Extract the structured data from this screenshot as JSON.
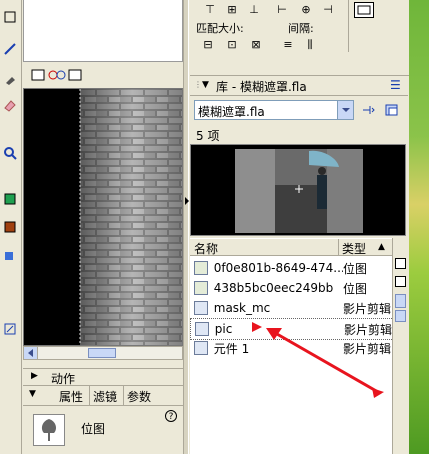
{
  "align_panel": {
    "match_size_label": "匹配大小:",
    "spacing_label": "间隔:"
  },
  "library": {
    "title": "库 - 模糊遮罩.fla",
    "dropdown_value": "模糊遮罩.fla",
    "item_count": "5 项",
    "col_name": "名称",
    "col_type": "类型",
    "items": [
      {
        "name": "0f0e801b-8649-474...",
        "type": "位图",
        "icon": "bitmap-icon"
      },
      {
        "name": "438b5bc0eec249bb",
        "type": "位图",
        "icon": "bitmap-icon"
      },
      {
        "name": "mask_mc",
        "type": "影片剪辑",
        "icon": "movieclip-icon"
      },
      {
        "name": "pic",
        "type": "影片剪辑",
        "icon": "movieclip-icon"
      },
      {
        "name": "元件 1",
        "type": "影片剪辑",
        "icon": "movieclip-icon"
      }
    ]
  },
  "bottom_panels": {
    "actions_label": "动作",
    "tab_properties": "属性",
    "tab_filters": "滤镜",
    "tab_params": "参数",
    "selection_type": "位图"
  },
  "colors": {
    "panel_bg": "#ece9d8",
    "annotation_arrow": "#e8141e",
    "selection_outline": "#333333"
  }
}
